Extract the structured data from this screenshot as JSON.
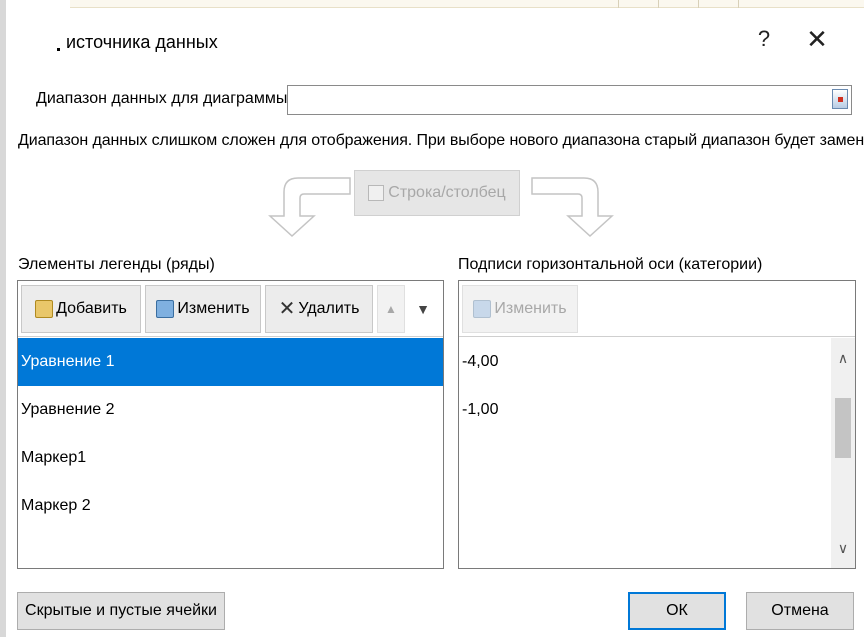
{
  "dialog": {
    "title": "источника данных",
    "help": "?",
    "close": "✕"
  },
  "range": {
    "label": "Диапазон данных для диаграммы:",
    "value": ""
  },
  "warning": "Диапазон данных слишком сложен для отображения. При выборе нового диапазона старый диапазон будет заменен.",
  "switch_button": "Строка/столбец",
  "legend": {
    "title": "Элементы легенды (ряды)",
    "add": "Добавить",
    "edit": "Изменить",
    "delete": "Удалить",
    "up": "▲",
    "down": "▼",
    "items": [
      "Уравнение 1",
      "Уравнение 2",
      "Маркер1",
      "Маркер 2"
    ],
    "selected_index": 0
  },
  "axis": {
    "title": "Подписи горизонтальной оси (категории)",
    "edit": "Изменить",
    "items": [
      "-4,00",
      "-1,00"
    ]
  },
  "buttons": {
    "hidden_cells": "Скрытые и пустые ячейки",
    "ok": "ОК",
    "cancel": "Отмена"
  },
  "colors": {
    "selection": "#0078d7",
    "default_button_border": "#0078d7"
  }
}
